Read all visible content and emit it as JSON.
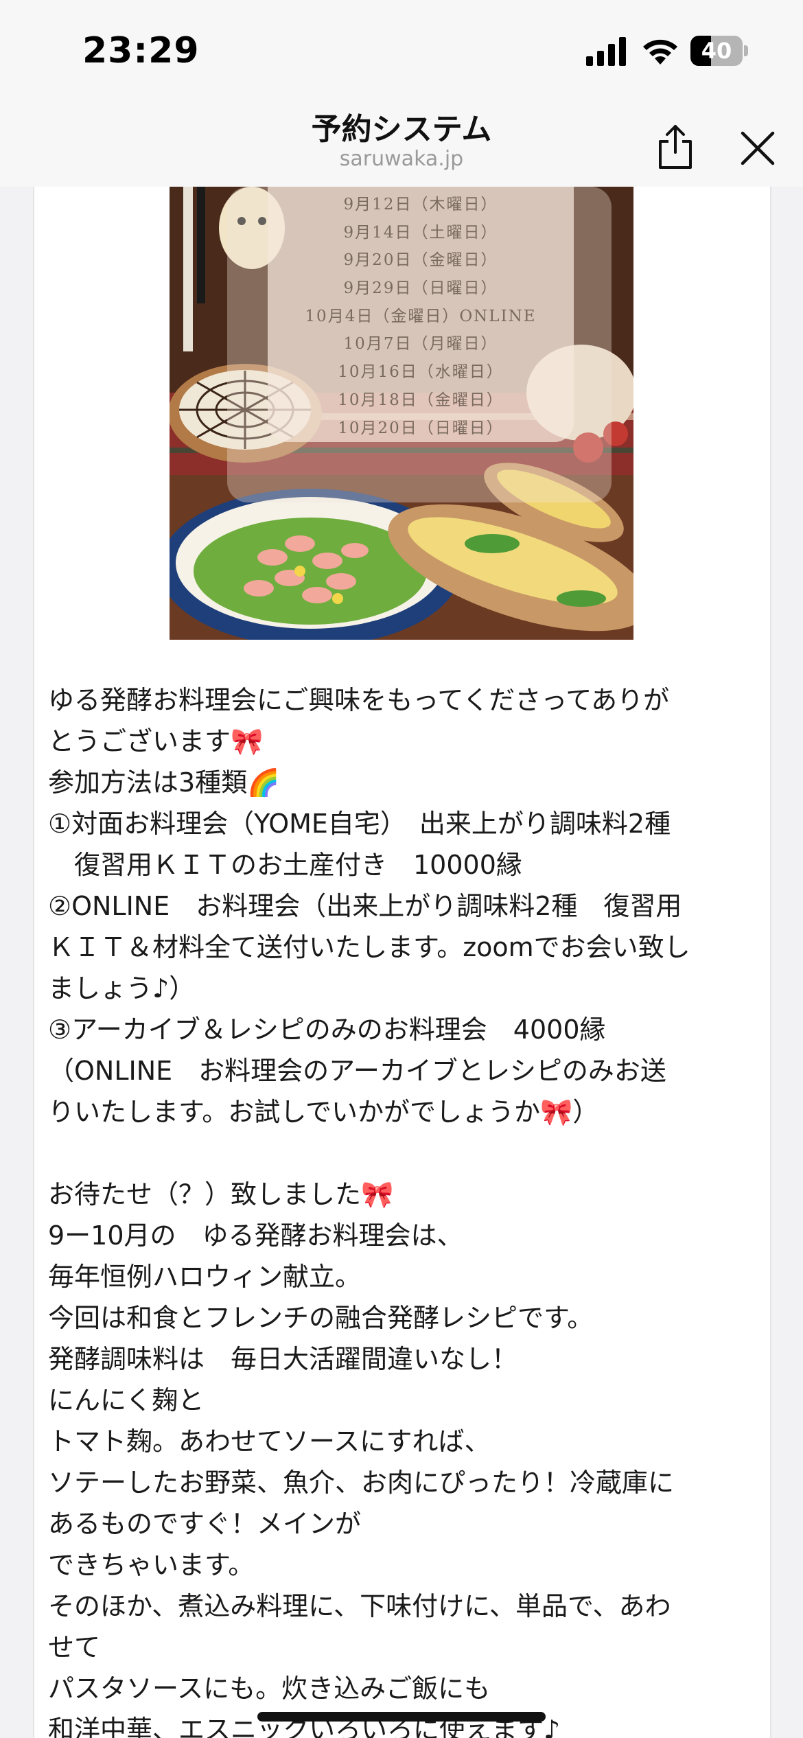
{
  "status_bar": {
    "time": "23:29",
    "battery": "40",
    "battery_level": 0.4
  },
  "nav": {
    "title": "予約システム",
    "domain": "saruwaka.jp",
    "share_icon": "share-icon",
    "close_icon": "close-icon"
  },
  "event_image": {
    "dates": [
      "9月12日（木曜日）",
      "9月14日（土曜日）",
      "9月20日（金曜日）",
      "9月29日（日曜日）",
      "10月4日（金曜日）ONLINE",
      "10月7日（月曜日）",
      "10月16日（水曜日）",
      "10月18日（金曜日）",
      "10月20日（日曜日）"
    ]
  },
  "post": {
    "lines": [
      "ゆる発酵お料理会にご興味をもってくださってありが",
      "とうございます🎀",
      "参加方法は3種類🌈",
      "①対面お料理会（YOME自宅）　出来上がり調味料2種",
      "　復習用ＫＩＴのお土産付き　10000縁",
      "②ONLINE　お料理会（出来上がり調味料2種　復習用",
      "ＫＩＴ＆材料全て送付いたします。zoomでお会い致し",
      "ましょう♪）",
      "③アーカイブ＆レシピのみのお料理会　4000縁",
      "（ONLINE　お料理会のアーカイブとレシピのみお送",
      "りいたします。お試しでいかがでしょうか🎀）",
      "",
      "お待たせ（？）致しました🎀",
      "9ー10月の　ゆる発酵お料理会は、",
      "毎年恒例ハロウィン献立。",
      "今回は和食とフレンチの融合発酵レシピです。",
      "発酵調味料は　毎日大活躍間違いなし！",
      "にんにく麹と",
      "トマト麹。あわせてソースにすれば、",
      "ソテーしたお野菜、魚介、お肉にぴったり！冷蔵庫に",
      "あるものですぐ！メインが",
      "できちゃいます。",
      "そのほか、煮込み料理に、下味付けに、単品で、あわ",
      "せて",
      "パスタソースにも。炊き込みご飯にも",
      "和洋中華、エスニックいろいろに使えます♪"
    ]
  }
}
